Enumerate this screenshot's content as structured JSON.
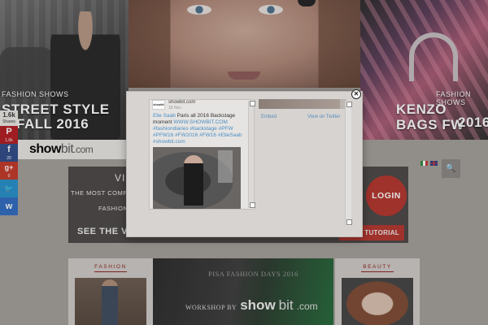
{
  "hero": {
    "left": {
      "category": "FASHION SHOWS",
      "title_line1": "STREET STYLE",
      "title_line2": "FALL 2016"
    },
    "right": {
      "category": "FASHION SHOWS",
      "title_line1": "KENZO BAGS FW",
      "title_line2": "2016"
    }
  },
  "logo": {
    "part1": "show",
    "part2": "bit",
    "part3": ".com"
  },
  "search": {
    "icon": "search-icon",
    "glyph": "🔍"
  },
  "social": {
    "count": "1.6k",
    "count_label": "Shares",
    "buttons": [
      {
        "icon": "pinterest-icon",
        "glyph": "P",
        "count": "1.6k"
      },
      {
        "icon": "facebook-icon",
        "glyph": "f",
        "count": "20"
      },
      {
        "icon": "google-plus-icon",
        "glyph": "g+",
        "count": "0"
      },
      {
        "icon": "twitter-icon",
        "glyph": "🐦",
        "count": ""
      },
      {
        "icon": "vk-icon",
        "glyph": "ᴡ",
        "count": ""
      }
    ]
  },
  "banner": {
    "vi": "VI",
    "most": "THE MOST COMP",
    "fashion": "FASHION",
    "see": "SEE THE VI",
    "login": "LOGIN",
    "tutorial": "TUTORIAL"
  },
  "tiles": {
    "fashion_label": "FASHION",
    "beauty_label": "BEAUTY",
    "pisa": "PISA FASHION DAYS 2016",
    "workshop_prefix": "WORKSHOP BY",
    "workshop_show": "show",
    "workshop_bit": "bit",
    "workshop_com": ".com"
  },
  "modal": {
    "close_glyph": "✕",
    "tweet": {
      "avatar_text": "showbit",
      "user": "showbit.com",
      "ago": "18 Nov",
      "author_link": "Elie Saab",
      "text_main": " Paris all 2016 Backstage moment ",
      "site_link": "WWW.SHOWBIT.COM",
      "hashtags": "#fashiondiaries #backstage #PFW #PFW16 #FW2016 #FW16 #ElieSaab #showbit.com"
    },
    "embed": "Embed",
    "view_on_twitter": "View on Twitter"
  },
  "colors": {
    "accent_red": "#b6342d",
    "link_blue": "#4b8ec4",
    "pinterest": "#b41c22",
    "facebook": "#2e4a8a",
    "google": "#c53827",
    "twitter": "#2591cc",
    "vk": "#2f6cc2"
  }
}
